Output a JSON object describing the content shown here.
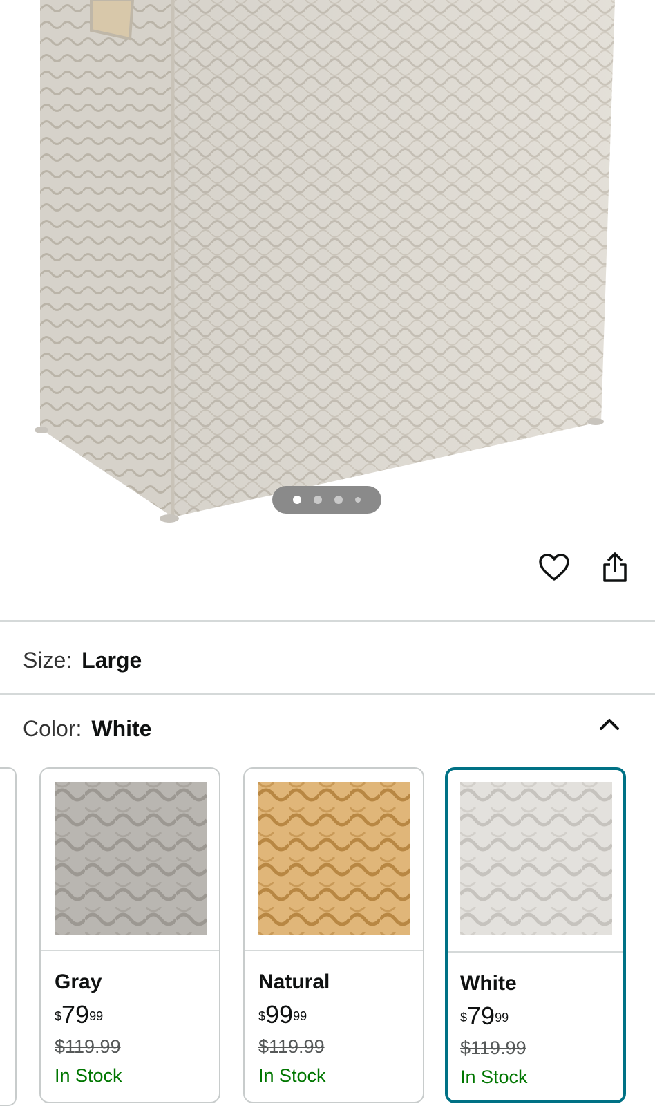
{
  "product": {
    "image_alt": "White woven water hyacinth laundry hamper",
    "carousel": {
      "count": 4,
      "active_index": 0
    }
  },
  "actions": {
    "wishlist_icon": "heart-outline-icon",
    "share_icon": "share-icon"
  },
  "size": {
    "label": "Size:",
    "value": "Large"
  },
  "color": {
    "label": "Color:",
    "value": "White",
    "expanded": true,
    "toggle_icon": "chevron-up-icon"
  },
  "swatches": [
    {
      "name": "Gray",
      "currency": "$",
      "price_whole": "79",
      "price_fraction": "99",
      "list_price": "$119.99",
      "availability": "In Stock",
      "texture_color": "#b9b6b1",
      "selected": false
    },
    {
      "name": "Natural",
      "currency": "$",
      "price_whole": "99",
      "price_fraction": "99",
      "list_price": "$119.99",
      "availability": "In Stock",
      "texture_color": "#d9ad6e",
      "selected": false
    },
    {
      "name": "White",
      "currency": "$",
      "price_whole": "79",
      "price_fraction": "99",
      "list_price": "$119.99",
      "availability": "In Stock",
      "texture_color": "#dcdad6",
      "selected": true
    }
  ],
  "colors": {
    "selected_border": "#007185",
    "in_stock": "#007600",
    "divider": "#d5d9d9"
  }
}
